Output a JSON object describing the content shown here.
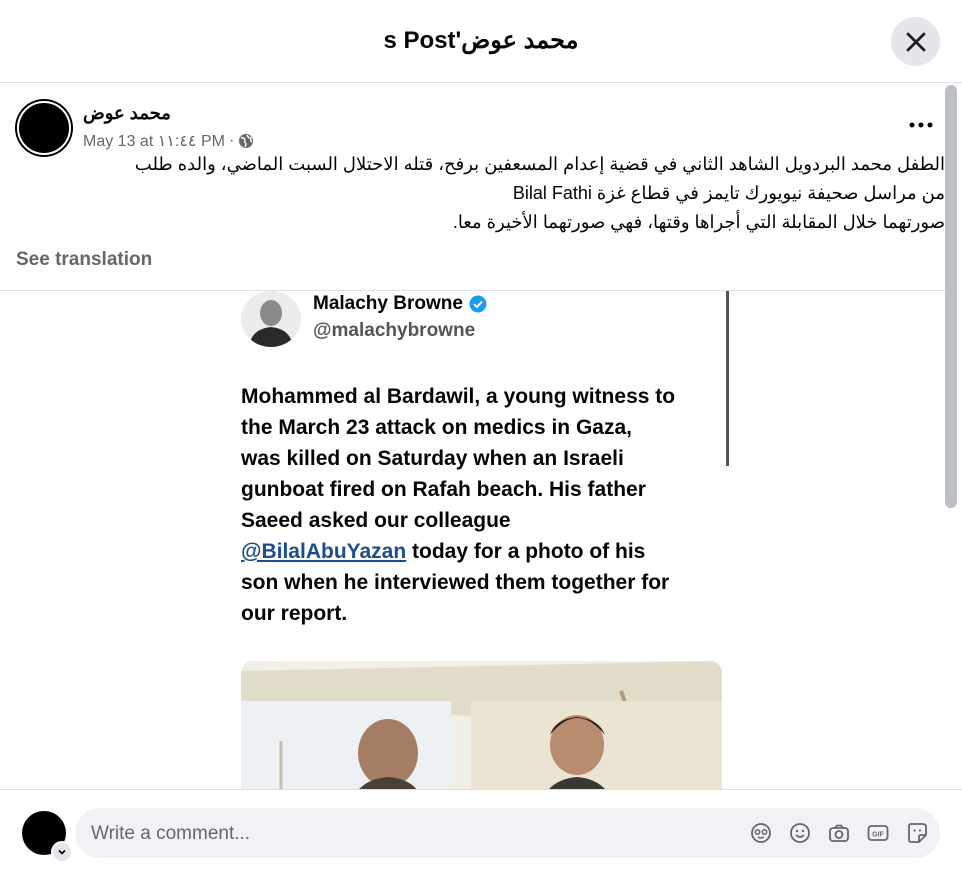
{
  "header": {
    "title": "محمد عوض's Post"
  },
  "post": {
    "author": "محمد عوض",
    "timestamp": "May 13 at ١١:٤٤ PM",
    "separator": "·",
    "text_lines": [
      "الطفل محمد البردويل الشاهد الثاني في قضية إعدام المسعفين برفح، قتله الاحتلال السبت الماضي، والده طلب",
      "من مراسل صحيفة نيويورك تايمز في قطاع غزة  Bilal Fathi",
      "صورتهما خلال المقابلة التي أجراها وقتها، فهي صورتهما الأخيرة معا."
    ],
    "see_translation": "See translation"
  },
  "embedded": {
    "name": "Malachy Browne",
    "handle": "@malachybrowne",
    "lines": [
      "Mohammed al Bardawil, a young witness to",
      "the March 23 attack on medics in Gaza,",
      "was killed on Saturday when an Israeli",
      "gunboat fired on Rafah beach. His father",
      "Saeed asked our colleague"
    ],
    "mention": "@BilalAbuYazan",
    "mention_rest": " today for a photo of his",
    "lines_after": [
      "son when he interviewed them together for",
      "our report."
    ]
  },
  "comment": {
    "placeholder": "Write a comment..."
  },
  "icons": {
    "close": "close-icon",
    "globe": "globe-icon",
    "more": "more-icon",
    "verified": "verified-badge-icon",
    "avatar_sticker": "avatar-sticker-icon",
    "emoji": "emoji-icon",
    "camera": "camera-icon",
    "gif": "gif-icon",
    "sticker": "sticker-icon"
  },
  "colors": {
    "accent": "#1877f2",
    "muted": "#65676b",
    "input_bg": "#f0f2f5"
  }
}
